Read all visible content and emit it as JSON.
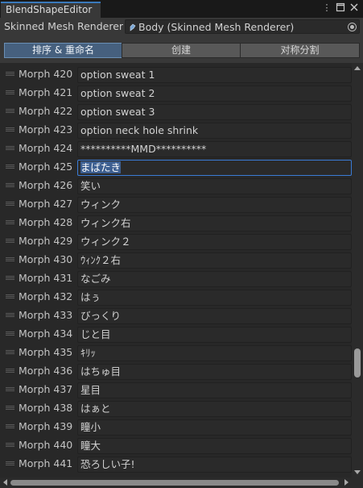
{
  "window": {
    "tab_title": "BlendShapeEditor",
    "menu_icon": "kebab-menu-icon",
    "maximize_icon": "maximize-icon",
    "close_icon": "close-icon"
  },
  "header": {
    "label": "Skinned Mesh Renderer",
    "field_value": "Body (Skinned Mesh Renderer)",
    "field_icon": "skinned-mesh-icon",
    "picker_icon": "object-picker-icon"
  },
  "toolbar": {
    "buttons": [
      {
        "label": "排序 & 重命名",
        "active": true
      },
      {
        "label": "创建",
        "active": false
      },
      {
        "label": "对称分割",
        "active": false
      }
    ]
  },
  "morphs": [
    {
      "label": "Morph 420",
      "value": "option sweat 1"
    },
    {
      "label": "Morph 421",
      "value": "option sweat 2"
    },
    {
      "label": "Morph 422",
      "value": "option sweat 3"
    },
    {
      "label": "Morph 423",
      "value": "option neck hole shrink"
    },
    {
      "label": "Morph 424",
      "value": "**********MMD**********"
    },
    {
      "label": "Morph 425",
      "value": "まばたき",
      "selected": true
    },
    {
      "label": "Morph 426",
      "value": "笑い"
    },
    {
      "label": "Morph 427",
      "value": "ウィンク"
    },
    {
      "label": "Morph 428",
      "value": "ウィンク右"
    },
    {
      "label": "Morph 429",
      "value": "ウィンク２"
    },
    {
      "label": "Morph 430",
      "value": "ｳｨﾝｸ２右"
    },
    {
      "label": "Morph 431",
      "value": "なごみ"
    },
    {
      "label": "Morph 432",
      "value": "はぅ"
    },
    {
      "label": "Morph 433",
      "value": "びっくり"
    },
    {
      "label": "Morph 434",
      "value": "じと目"
    },
    {
      "label": "Morph 435",
      "value": "ｷﾘｯ"
    },
    {
      "label": "Morph 436",
      "value": "はちゅ目"
    },
    {
      "label": "Morph 437",
      "value": "星目"
    },
    {
      "label": "Morph 438",
      "value": "はぁと"
    },
    {
      "label": "Morph 439",
      "value": "瞳小"
    },
    {
      "label": "Morph 440",
      "value": "瞳大"
    },
    {
      "label": "Morph 441",
      "value": "恐ろしい子!"
    }
  ],
  "scrollbars": {
    "vertical_position": 0.72,
    "up_arrow_icon": "scroll-up-arrow-icon",
    "down_arrow_icon": "scroll-down-arrow-icon",
    "left_arrow_icon": "scroll-left-arrow-icon",
    "right_arrow_icon": "scroll-right-arrow-icon"
  },
  "colors": {
    "accent": "#3a79bb",
    "active_tab": "#46607e",
    "background": "#282828"
  }
}
